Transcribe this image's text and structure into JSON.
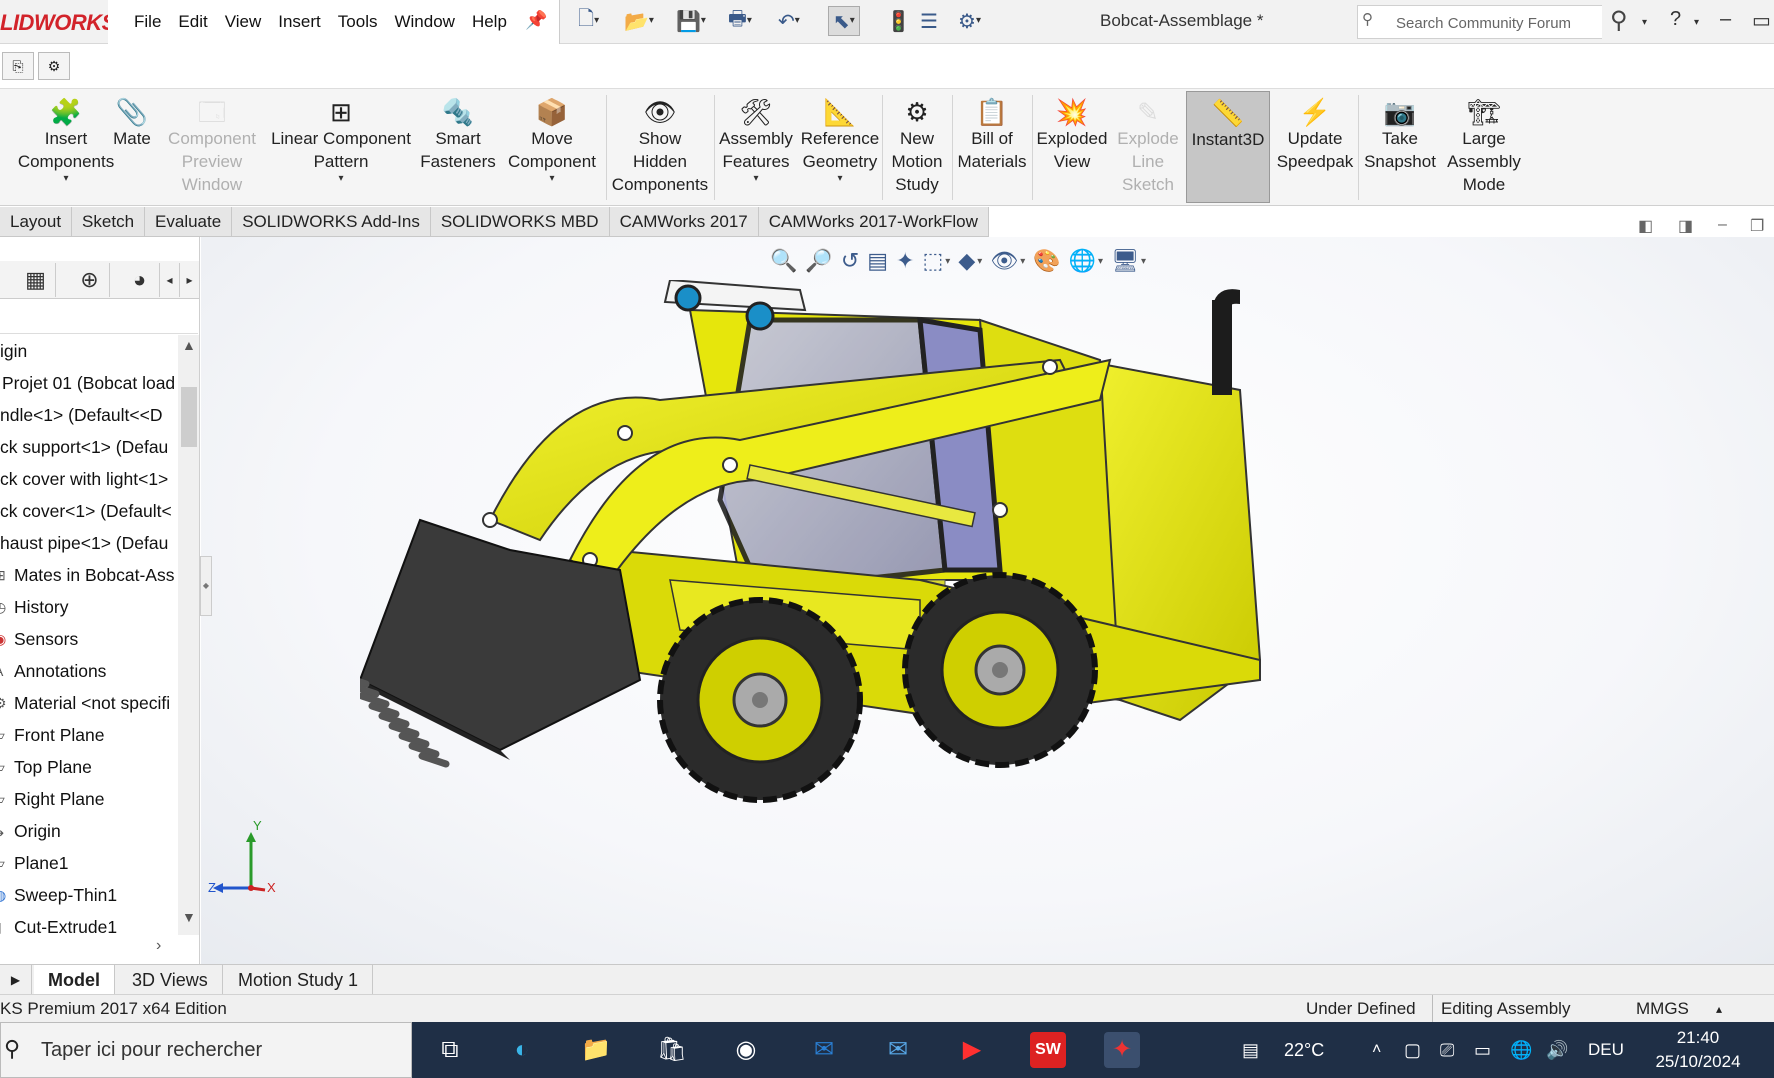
{
  "app": {
    "logo": "LIDWORKS",
    "document_title": "Bobcat-Assemblage *",
    "search_placeholder": "Search Community Forum"
  },
  "menu": [
    "File",
    "Edit",
    "View",
    "Insert",
    "Tools",
    "Window",
    "Help"
  ],
  "ribbon": [
    {
      "label": "Insert\nComponents",
      "icon": "insert-components-icon",
      "caret": true,
      "disabled": false
    },
    {
      "label": "Mate",
      "icon": "mate-icon",
      "caret": false,
      "disabled": false
    },
    {
      "label": "Component\nPreview\nWindow",
      "icon": "component-preview-icon",
      "caret": false,
      "disabled": true
    },
    {
      "label": "Linear Component\nPattern",
      "icon": "linear-pattern-icon",
      "caret": true,
      "disabled": false
    },
    {
      "label": "Smart\nFasteners",
      "icon": "smart-fasteners-icon",
      "caret": false,
      "disabled": false
    },
    {
      "label": "Move\nComponent",
      "icon": "move-component-icon",
      "caret": true,
      "disabled": false
    },
    {
      "label": "Show\nHidden\nComponents",
      "icon": "show-hidden-icon",
      "caret": false,
      "disabled": false
    },
    {
      "label": "Assembly\nFeatures",
      "icon": "assembly-features-icon",
      "caret": true,
      "disabled": false
    },
    {
      "label": "Reference\nGeometry",
      "icon": "reference-geometry-icon",
      "caret": true,
      "disabled": false
    },
    {
      "label": "New\nMotion\nStudy",
      "icon": "motion-study-icon",
      "caret": false,
      "disabled": false
    },
    {
      "label": "Bill of\nMaterials",
      "icon": "bom-icon",
      "caret": false,
      "disabled": false
    },
    {
      "label": "Exploded\nView",
      "icon": "exploded-view-icon",
      "caret": false,
      "disabled": false
    },
    {
      "label": "Explode\nLine\nSketch",
      "icon": "explode-line-icon",
      "caret": false,
      "disabled": true
    },
    {
      "label": "Instant3D",
      "icon": "instant3d-icon",
      "caret": false,
      "disabled": false,
      "active": true
    },
    {
      "label": "Update\nSpeedpak",
      "icon": "speedpak-icon",
      "caret": false,
      "disabled": false
    },
    {
      "label": "Take\nSnapshot",
      "icon": "camera-icon",
      "caret": false,
      "disabled": false
    },
    {
      "label": "Large\nAssembly\nMode",
      "icon": "large-assembly-icon",
      "caret": false,
      "disabled": false
    }
  ],
  "command_tabs": [
    "Layout",
    "Sketch",
    "Evaluate",
    "SOLIDWORKS Add-Ins",
    "SOLIDWORKS MBD",
    "CAMWorks 2017",
    "CAMWorks 2017-WorkFlow"
  ],
  "tree": [
    "igin",
    "Projet 01 (Bobcat load",
    "ndle<1> (Default<<D",
    "ck support<1> (Defau",
    "ck cover with light<1>",
    "ck cover<1> (Default<",
    "haust  pipe<1> (Defau",
    "Mates in Bobcat-Ass",
    "History",
    "Sensors",
    "Annotations",
    "Material <not specifi",
    "Front Plane",
    "Top Plane",
    "Right Plane",
    "Origin",
    "Plane1",
    "Sweep-Thin1",
    "Cut-Extrude1"
  ],
  "triad": {
    "x": "X",
    "y": "Y",
    "z": "Z"
  },
  "bottom_tabs": [
    "Model",
    "3D Views",
    "Motion Study 1"
  ],
  "status": {
    "edition": "KS Premium 2017 x64 Edition",
    "state": "Under Defined",
    "mode": "Editing Assembly",
    "units": "MMGS"
  },
  "taskbar": {
    "search_placeholder": "Taper ici pour rechercher",
    "weather": "22°C",
    "language": "DEU",
    "time": "21:40",
    "date": "25/10/2024"
  },
  "colors": {
    "machine_yellow": "#e6e600",
    "bucket": "#3a3a3a",
    "tire": "#2b2b2b",
    "glass": "#a9abd6"
  }
}
